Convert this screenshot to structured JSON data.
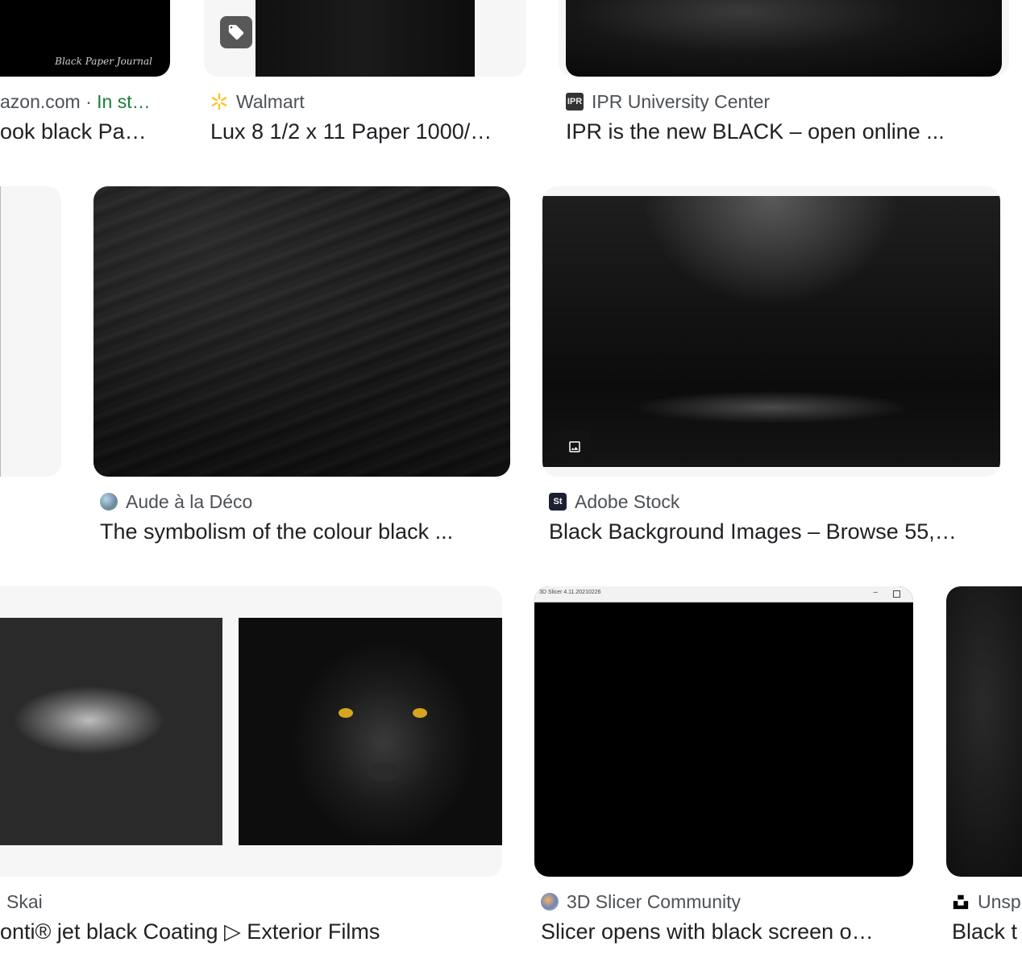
{
  "results": [
    {
      "source": "azon.com",
      "separator": " · ",
      "stock": "In st…",
      "title": "ook black Pa…",
      "image_caption": "Black Paper Journal"
    },
    {
      "source": "Walmart",
      "title": "Lux 8 1/2 x 11 Paper 1000/…",
      "badge_icon": "tag-icon"
    },
    {
      "source": "IPR University Center",
      "favicon_text": "IPR",
      "title": "IPR is the new BLACK – open online ..."
    },
    {
      "source": "Aude à la Déco",
      "title": "The symbolism of the colour black ..."
    },
    {
      "source": "Adobe Stock",
      "favicon_text": "St",
      "title": "Black Background Images – Browse 55,…",
      "badge_icon": "image-icon"
    },
    {
      "source": "Skai",
      "title": "onti® jet black Coating ▷ Exterior Films"
    },
    {
      "source": "3D Slicer Community",
      "title": "Slicer opens with black screen o…",
      "window_title": "3D Slicer 4.11.20210226"
    },
    {
      "source": "Unsp",
      "title": "Black t"
    }
  ],
  "colors": {
    "stock_green": "#188038",
    "walmart_yellow": "#ffc220"
  }
}
